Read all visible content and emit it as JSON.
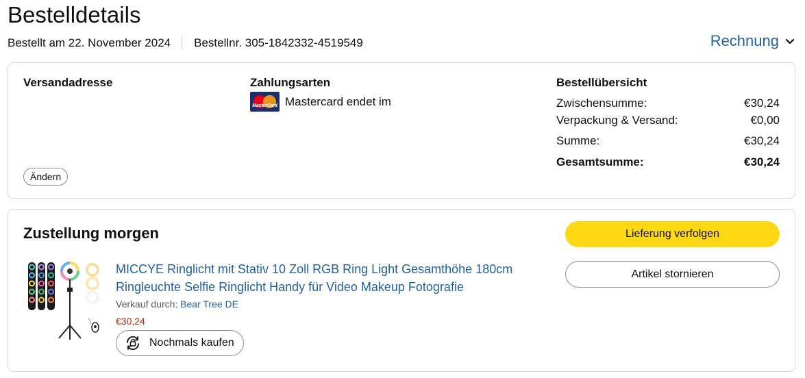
{
  "header": {
    "title": "Bestelldetails",
    "ordered_on": "Bestellt am 22. November 2024",
    "order_number": "Bestellnr. 305-1842332-4519549",
    "invoice_label": "Rechnung"
  },
  "summary_card": {
    "shipping_heading": "Versandadresse",
    "change_button": "Ändern",
    "payment_heading": "Zahlungsarten",
    "payment_method": "Mastercard endet im",
    "payment_logo_text": "MasterCard",
    "overview_heading": "Bestellübersicht",
    "rows": [
      {
        "label": "Zwischensumme:",
        "value": "€30,24"
      },
      {
        "label": "Verpackung & Versand:",
        "value": "€0,00"
      },
      {
        "label": "Summe:",
        "value": "€30,24"
      },
      {
        "label": "Gesamtsumme:",
        "value": "€30,24"
      }
    ]
  },
  "delivery_card": {
    "heading": "Zustellung morgen",
    "track_button": "Lieferung verfolgen",
    "cancel_button": "Artikel stornieren",
    "product": {
      "title": "MICCYE Ringlicht mit Stativ 10 Zoll RGB Ring Light Gesamthöhe 180cm Ringleuchte Selfie Ringlicht Handy für Video Makeup Fotografie",
      "seller_prefix": "Verkauf durch:",
      "seller_name": "Bear Tree DE",
      "price": "€30,24",
      "rebuy_button": "Nochmals kaufen"
    }
  },
  "colors": {
    "link": "#2162a1",
    "price": "#b12704",
    "primary_button": "#ffd814",
    "border": "#d5d9d9"
  }
}
